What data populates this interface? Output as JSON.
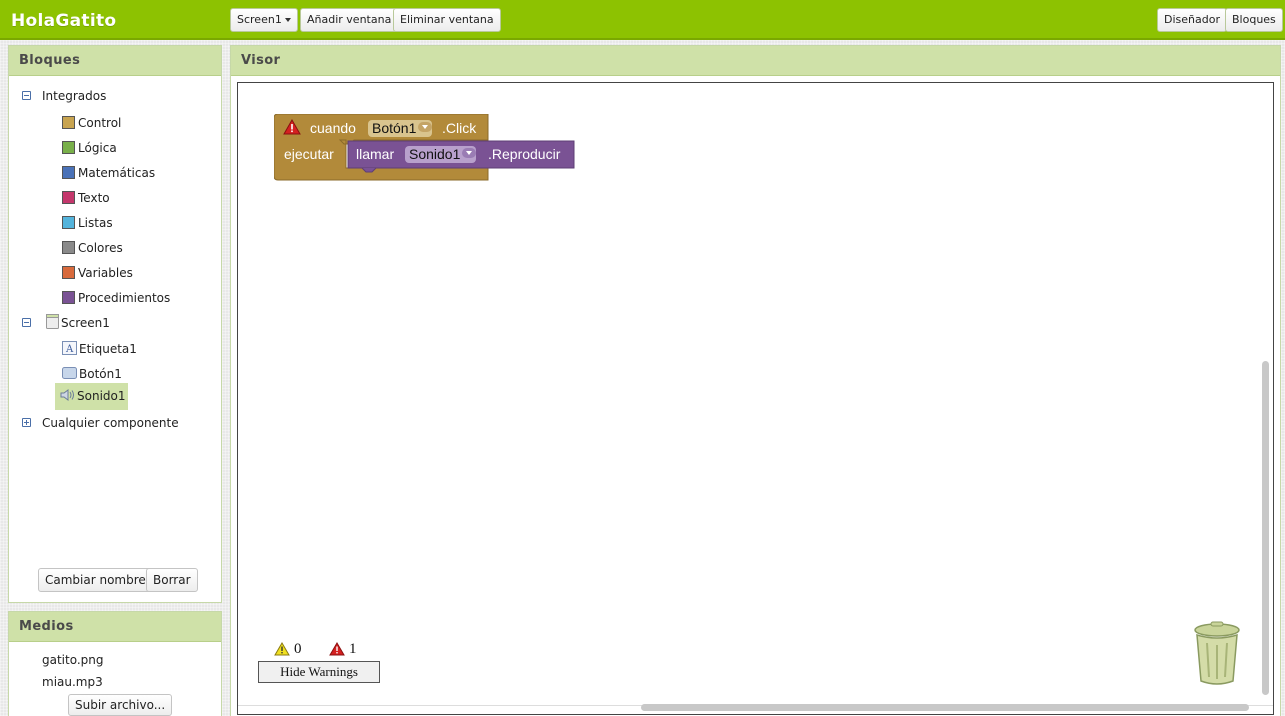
{
  "app": {
    "title": "HolaGatito"
  },
  "toolbar": {
    "screen_select": "Screen1",
    "add_screen": "Añadir ventana",
    "remove_screen": "Eliminar ventana",
    "designer": "Diseñador",
    "blocks": "Bloques"
  },
  "blocks_panel": {
    "title": "Bloques",
    "builtin": {
      "label": "Integrados",
      "items": [
        {
          "label": "Control",
          "color": "#c8a450"
        },
        {
          "label": "Lógica",
          "color": "#79b04a"
        },
        {
          "label": "Matemáticas",
          "color": "#4a72b8"
        },
        {
          "label": "Texto",
          "color": "#c4376c"
        },
        {
          "label": "Listas",
          "color": "#54b4dc"
        },
        {
          "label": "Colores",
          "color": "#8a8a8a"
        },
        {
          "label": "Variables",
          "color": "#d86a3c"
        },
        {
          "label": "Procedimientos",
          "color": "#7a5294"
        }
      ]
    },
    "screen": {
      "label": "Screen1",
      "components": [
        {
          "label": "Etiqueta1",
          "icon": "label-icon"
        },
        {
          "label": "Botón1",
          "icon": "button-icon"
        },
        {
          "label": "Sonido1",
          "icon": "sound-icon",
          "selected": true
        }
      ]
    },
    "any_component": "Cualquier componente",
    "rename_button": "Cambiar nombre",
    "delete_button": "Borrar"
  },
  "media_panel": {
    "title": "Medios",
    "files": [
      "gatito.png",
      "miau.mp3"
    ],
    "upload_button": "Subir archivo..."
  },
  "viewer": {
    "title": "Visor",
    "event_block": {
      "when": "cuando",
      "component": "Botón1",
      "event": ".Click",
      "do": "ejecutar",
      "color": "#b28a3a"
    },
    "call_block": {
      "call": "llamar",
      "component": "Sonido1",
      "method": ".Reproducir",
      "color": "#7a5294"
    },
    "warnings": {
      "warning_count": "0",
      "error_count": "1",
      "toggle_button": "Hide Warnings"
    }
  }
}
